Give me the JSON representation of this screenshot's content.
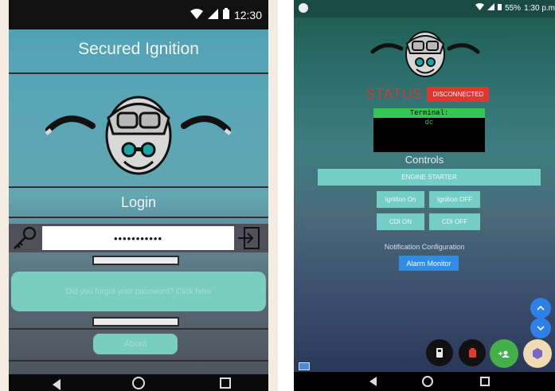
{
  "left_app": {
    "status_bar": {
      "time": "12:30",
      "wifi_icon": "wifi-icon",
      "signal_icon": "signal-icon",
      "battery_icon": "battery-icon"
    },
    "title": "Secured Ignition",
    "logo_icon": "helmet-goggles-logo",
    "login_heading": "Login",
    "password_field": {
      "value": "•••••••••••",
      "key_icon": "key-icon",
      "submit_icon": "login-arrow-icon"
    },
    "forgot_password_text": "Did you forgot your password? Click here",
    "about_label": "About",
    "colors": {
      "accent": "#79cec0",
      "status_bar": "#111111"
    }
  },
  "right_app": {
    "status_bar": {
      "time": "1:30 p.m",
      "battery": "55%"
    },
    "logo_icon": "helmet-goggles-logo",
    "status_label": "STATUS",
    "connection_badge": "DISCONNECTED",
    "terminal": {
      "header": "Terminal:",
      "text": "dc"
    },
    "controls_heading": "Controls",
    "engine_starter_label": "ENGINE STARTER",
    "ignition_on_label": "Ignition On",
    "ignition_off_label": "Ignition OFF",
    "cdi_on_label": "CDI ON",
    "cdi_off_label": "CDI OFF",
    "notification_heading": "Notification Configuration",
    "alarm_monitor_label": "Alarm Monitor",
    "colors": {
      "accent": "#74cdc7",
      "status_red": "#e0362f",
      "terminal_green": "#35c651",
      "alarm_blue": "#2f8de8"
    }
  }
}
